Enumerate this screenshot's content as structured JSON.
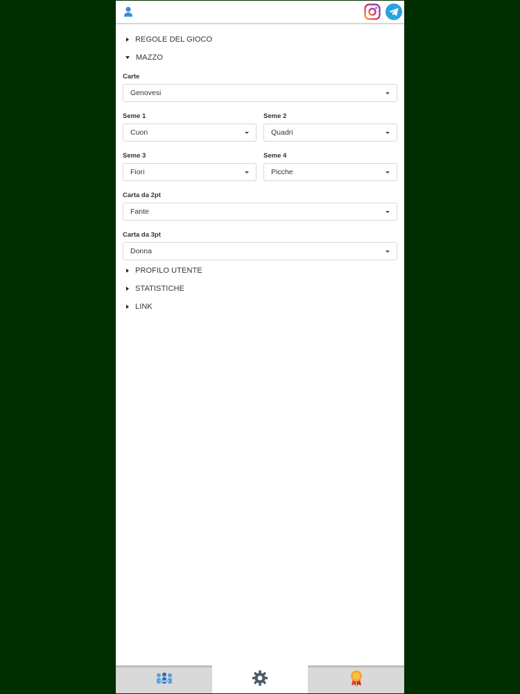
{
  "header": {
    "user_icon": "user-icon",
    "social": [
      "instagram-icon",
      "telegram-icon"
    ]
  },
  "sections": {
    "rules": "REGOLE DEL GIOCO",
    "deck": "MAZZO",
    "profile": "PROFILO UTENTE",
    "stats": "STATISTICHE",
    "link": "LINK"
  },
  "deck_settings": {
    "cards_label": "Carte",
    "cards_value": "Genovesi",
    "suit1_label": "Seme 1",
    "suit1_value": "Cuori",
    "suit2_label": "Seme 2",
    "suit2_value": "Quadri",
    "suit3_label": "Seme 3",
    "suit3_value": "Fiori",
    "suit4_label": "Seme 4",
    "suit4_value": "Picche",
    "card2_label": "Carta da 2pt",
    "card2_value": "Fante",
    "card3_label": "Carta da 3pt",
    "card3_value": "Donna"
  },
  "bottom_nav": {
    "tabs": [
      "players-icon",
      "gear-icon",
      "award-icon"
    ],
    "active": "gear-icon"
  },
  "colors": {
    "background": "#002e00",
    "accent_blue": "#3a8fd6",
    "telegram": "#2aa3dc",
    "award": "#f5a623"
  }
}
